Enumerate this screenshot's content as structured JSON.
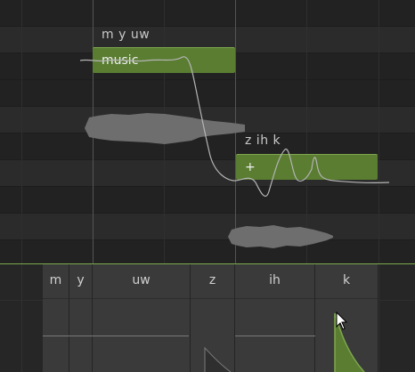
{
  "lyrics": {
    "phrase_1": "m y uw",
    "phrase_2": "z ih k"
  },
  "notes": {
    "note_1_label": "music",
    "note_2_label": "+"
  },
  "phonemes": [
    "m",
    "y",
    "uw",
    "z",
    "ih",
    "k"
  ],
  "colors": {
    "note_fill": "#5a7d32",
    "note_border": "#7ea84e",
    "pitch_curve": "#b5b5b5",
    "waveform": "#6e6e6e",
    "divider": "#7ea84e"
  },
  "icons": {
    "cursor": "mouse-pointer-icon"
  }
}
